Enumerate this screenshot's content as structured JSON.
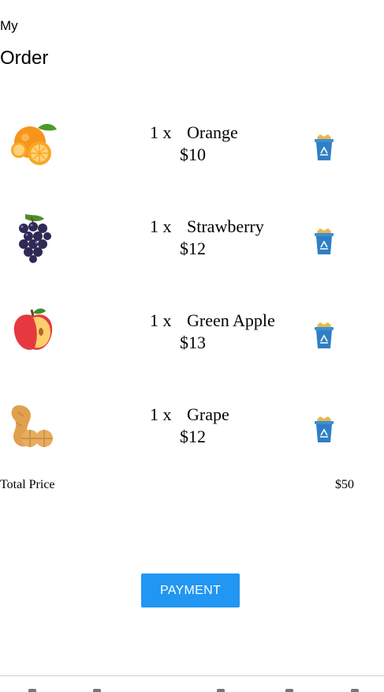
{
  "header": {
    "line1": "My",
    "line2": "Order"
  },
  "items": [
    {
      "qty": "1 x",
      "name": "Orange",
      "price": "$10",
      "icon": "orange-icon"
    },
    {
      "qty": "1 x",
      "name": "Strawberry",
      "price": "$12",
      "icon": "grapes-icon"
    },
    {
      "qty": "1 x",
      "name": "Green Apple",
      "price": "$13",
      "icon": "apple-icon"
    },
    {
      "qty": "1 x",
      "name": "Grape",
      "price": "$12",
      "icon": "peanut-icon"
    }
  ],
  "total": {
    "label": "Total Price",
    "value": "$50"
  },
  "payment_button": "PAYMENT",
  "colors": {
    "accent": "#2196f3",
    "bin": "#2f7fc4"
  }
}
